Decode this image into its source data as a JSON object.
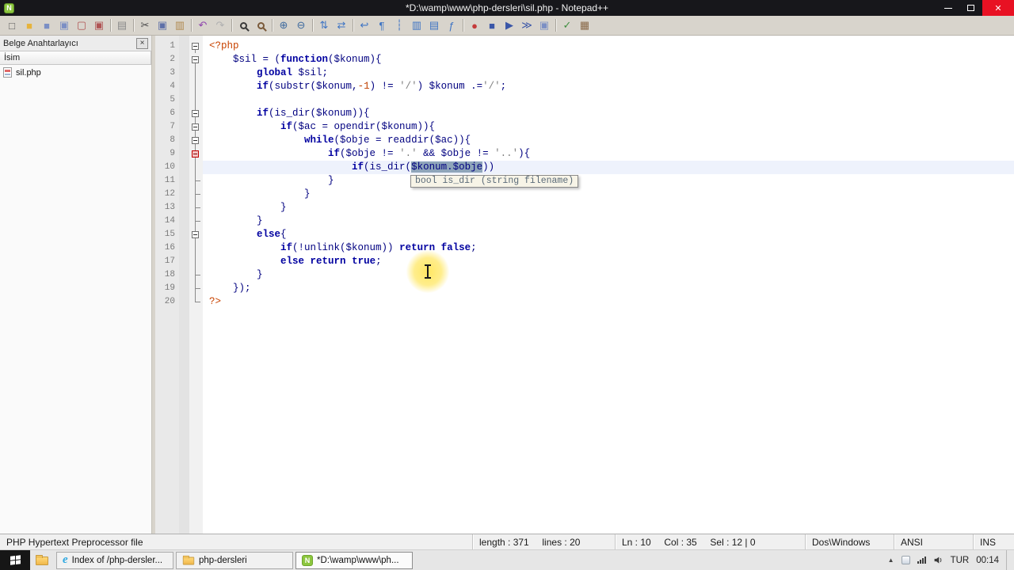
{
  "colors": {
    "accent_title": "#17171b",
    "close_red": "#e81123",
    "kw": "#0000a0",
    "def": "#000080",
    "str": "#808080",
    "num": "#c04000",
    "tag": "#c84300",
    "sel_bg": "#8fa5ba",
    "calltip_bg": "#f7f4e7",
    "current_line": "#eef2fc",
    "npp_green": "#8cc63e",
    "ie_blue": "#2fa8e1"
  },
  "window": {
    "title": "*D:\\wamp\\www\\php-dersleri\\sil.php - Notepad++",
    "app_icon": "N"
  },
  "toolbar": {
    "items": [
      {
        "n": "new-file-icon",
        "g": "□",
        "c": "#5a5a5a"
      },
      {
        "n": "open-file-icon",
        "g": "■",
        "c": "#e6b33c"
      },
      {
        "n": "save-icon",
        "g": "■",
        "c": "#7b8fc4"
      },
      {
        "n": "save-all-icon",
        "g": "▣",
        "c": "#7b8fc4"
      },
      {
        "n": "close-file-icon",
        "g": "▢",
        "c": "#b05454"
      },
      {
        "n": "close-all-icon",
        "g": "▣",
        "c": "#b05454"
      },
      {
        "sep": true
      },
      {
        "n": "print-icon",
        "g": "▤",
        "c": "#8a8a8a"
      },
      {
        "sep": true
      },
      {
        "n": "cut-icon",
        "g": "✂",
        "c": "#4a4a4a"
      },
      {
        "n": "copy-icon",
        "g": "▣",
        "c": "#5e6fa8"
      },
      {
        "n": "paste-icon",
        "g": "▥",
        "c": "#b08a50"
      },
      {
        "sep": true
      },
      {
        "n": "undo-icon",
        "g": "↶",
        "c": "#8e44ad"
      },
      {
        "n": "redo-icon",
        "g": "↷",
        "c": "#b0b0b0"
      },
      {
        "sep": true
      },
      {
        "n": "find-icon",
        "g": "mag",
        "c": "#3a3a3a"
      },
      {
        "n": "replace-icon",
        "g": "mag",
        "c": "#7a5a3a"
      },
      {
        "sep": true
      },
      {
        "n": "zoom-in-icon",
        "g": "⊕",
        "c": "#3e6a9e"
      },
      {
        "n": "zoom-out-icon",
        "g": "⊖",
        "c": "#3e6a9e"
      },
      {
        "sep": true
      },
      {
        "n": "sync-vertical-scroll-icon",
        "g": "⇅",
        "c": "#3e74c4"
      },
      {
        "n": "sync-horizontal-scroll-icon",
        "g": "⇄",
        "c": "#3e74c4"
      },
      {
        "sep": true
      },
      {
        "n": "word-wrap-icon",
        "g": "↩",
        "c": "#3e74c4"
      },
      {
        "n": "show-all-characters-icon",
        "g": "¶",
        "c": "#3e74c4"
      },
      {
        "n": "indent-guide-icon",
        "g": "┆",
        "c": "#3e74c4"
      },
      {
        "n": "document-map-icon",
        "g": "▥",
        "c": "#3e74c4"
      },
      {
        "n": "doc-switcher-icon",
        "g": "▤",
        "c": "#3e74c4"
      },
      {
        "n": "function-list-icon",
        "g": "ƒ",
        "c": "#3e74c4"
      },
      {
        "sep": true
      },
      {
        "n": "record-macro-icon",
        "g": "●",
        "c": "#c43a3a"
      },
      {
        "n": "stop-recording-icon",
        "g": "■",
        "c": "#3a56a8"
      },
      {
        "n": "playback-macro-icon",
        "g": "▶",
        "c": "#3a56a8"
      },
      {
        "n": "run-macro-multiple-times-icon",
        "g": "≫",
        "c": "#3a56a8"
      },
      {
        "n": "save-recorded-macro-icon",
        "g": "▣",
        "c": "#7b8fc4"
      },
      {
        "sep": true
      },
      {
        "n": "spell-check-icon",
        "g": "✓",
        "c": "#3e8e3e"
      },
      {
        "n": "plugin-action-icon",
        "g": "▦",
        "c": "#8a6a4a"
      }
    ]
  },
  "doc_panel": {
    "title": "Belge Anahtarlayıcı",
    "close_glyph": "×",
    "column_header": "İsim",
    "files": [
      {
        "name": "sil.php"
      }
    ]
  },
  "editor": {
    "calltip": "bool is_dir (string filename)",
    "lines": [
      {
        "n": 1,
        "f": "box",
        "t": [
          {
            "s": "t",
            "x": "<?php"
          }
        ]
      },
      {
        "n": 2,
        "f": "box",
        "t": [
          {
            "s": "d",
            "x": "    $sil = ("
          },
          {
            "s": "k",
            "x": "function"
          },
          {
            "s": "d",
            "x": "($konum){"
          }
        ]
      },
      {
        "n": 3,
        "f": "line",
        "t": [
          {
            "s": "d",
            "x": "        "
          },
          {
            "s": "k",
            "x": "global"
          },
          {
            "s": "d",
            "x": " $sil;"
          }
        ]
      },
      {
        "n": 4,
        "f": "line",
        "t": [
          {
            "s": "d",
            "x": "        "
          },
          {
            "s": "k",
            "x": "if"
          },
          {
            "s": "d",
            "x": "(substr($konum,"
          },
          {
            "s": "n",
            "x": "-1"
          },
          {
            "s": "d",
            "x": ") != "
          },
          {
            "s": "s",
            "x": "'/'"
          },
          {
            "s": "d",
            "x": ") $konum .="
          },
          {
            "s": "s",
            "x": "'/'"
          },
          {
            "s": "d",
            "x": ";"
          }
        ]
      },
      {
        "n": 5,
        "f": "line",
        "t": []
      },
      {
        "n": 6,
        "f": "boxh",
        "t": [
          {
            "s": "d",
            "x": "        "
          },
          {
            "s": "k",
            "x": "if"
          },
          {
            "s": "d",
            "x": "(is_dir($konum)){"
          }
        ]
      },
      {
        "n": 7,
        "f": "boxh",
        "t": [
          {
            "s": "d",
            "x": "            "
          },
          {
            "s": "k",
            "x": "if"
          },
          {
            "s": "d",
            "x": "($ac = opendir($konum)){"
          }
        ]
      },
      {
        "n": 8,
        "f": "boxh",
        "t": [
          {
            "s": "d",
            "x": "                "
          },
          {
            "s": "k",
            "x": "while"
          },
          {
            "s": "d",
            "x": "($obje = readdir($ac)){"
          }
        ]
      },
      {
        "n": 9,
        "f": "boxa",
        "t": [
          {
            "s": "d",
            "x": "                    "
          },
          {
            "s": "k",
            "x": "if"
          },
          {
            "s": "d",
            "x": "($obje != "
          },
          {
            "s": "s",
            "x": "'.'"
          },
          {
            "s": "d",
            "x": " && $obje != "
          },
          {
            "s": "s",
            "x": "'..'"
          },
          {
            "s": "d",
            "x": "){"
          }
        ]
      },
      {
        "n": 10,
        "f": "line",
        "cur": true,
        "t": [
          {
            "s": "d",
            "x": "                        "
          },
          {
            "s": "k",
            "x": "if"
          },
          {
            "s": "d",
            "x": "(is_dir("
          },
          {
            "s": "sel",
            "x": "$konum.$obje"
          },
          {
            "s": "d",
            "x": "))"
          }
        ]
      },
      {
        "n": 11,
        "f": "endc",
        "t": [
          {
            "s": "d",
            "x": "                    }"
          }
        ]
      },
      {
        "n": 12,
        "f": "endc",
        "t": [
          {
            "s": "d",
            "x": "                }"
          }
        ]
      },
      {
        "n": 13,
        "f": "endc",
        "t": [
          {
            "s": "d",
            "x": "            }"
          }
        ]
      },
      {
        "n": 14,
        "f": "endc",
        "t": [
          {
            "s": "d",
            "x": "        }"
          }
        ]
      },
      {
        "n": 15,
        "f": "boxh",
        "t": [
          {
            "s": "d",
            "x": "        "
          },
          {
            "s": "k",
            "x": "else"
          },
          {
            "s": "d",
            "x": "{"
          }
        ]
      },
      {
        "n": 16,
        "f": "line",
        "t": [
          {
            "s": "d",
            "x": "            "
          },
          {
            "s": "k",
            "x": "if"
          },
          {
            "s": "d",
            "x": "(!unlink($konum)) "
          },
          {
            "s": "k",
            "x": "return"
          },
          {
            "s": "d",
            "x": " "
          },
          {
            "s": "k",
            "x": "false"
          },
          {
            "s": "d",
            "x": ";"
          }
        ]
      },
      {
        "n": 17,
        "f": "line",
        "t": [
          {
            "s": "d",
            "x": "            "
          },
          {
            "s": "k",
            "x": "else"
          },
          {
            "s": "d",
            "x": " "
          },
          {
            "s": "k",
            "x": "return"
          },
          {
            "s": "d",
            "x": " "
          },
          {
            "s": "k",
            "x": "true"
          },
          {
            "s": "d",
            "x": ";"
          }
        ]
      },
      {
        "n": 18,
        "f": "endc",
        "t": [
          {
            "s": "d",
            "x": "        }"
          }
        ]
      },
      {
        "n": 19,
        "f": "endc",
        "t": [
          {
            "s": "d",
            "x": "    });"
          }
        ]
      },
      {
        "n": 20,
        "f": "end",
        "t": [
          {
            "s": "t",
            "x": "?>"
          }
        ]
      }
    ]
  },
  "statusbar": {
    "doctype": "PHP Hypertext Preprocessor file",
    "length": "length : 371     lines : 20",
    "position": "Ln : 10     Col : 35     Sel : 12 | 0",
    "eol": "Dos\\Windows",
    "encoding": "ANSI",
    "insert": "INS"
  },
  "taskbar": {
    "buttons": [
      {
        "label": "Index of /php-dersler..."
      },
      {
        "label": "php-dersleri"
      },
      {
        "label": "*D:\\wamp\\www\\ph..."
      }
    ],
    "tray": {
      "expand_glyph": "▲",
      "lang": "TUR",
      "time": "00:14"
    }
  }
}
